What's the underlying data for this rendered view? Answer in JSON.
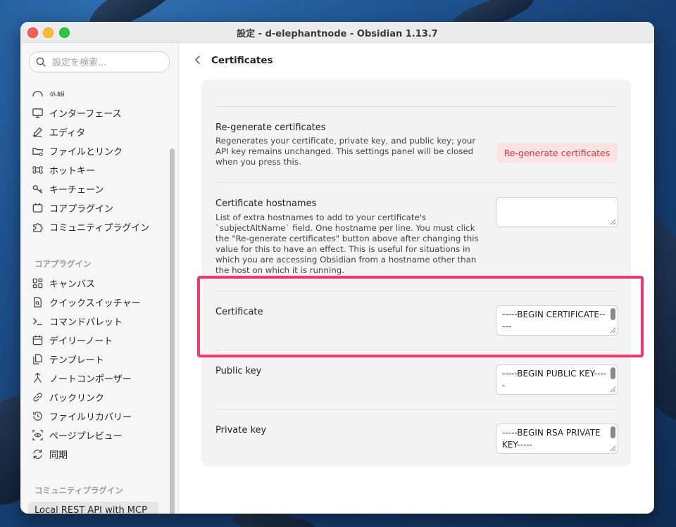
{
  "window": {
    "title": "設定 - d-elephantnode - Obsidian 1.13.7"
  },
  "sidebar": {
    "search_placeholder": "設定を検索...",
    "partial_item": "外観",
    "options_items": [
      {
        "label": "インターフェース",
        "icon": "monitor-icon"
      },
      {
        "label": "エディタ",
        "icon": "pencil-icon"
      },
      {
        "label": "ファイルとリンク",
        "icon": "folder-link-icon"
      },
      {
        "label": "ホットキー",
        "icon": "command-icon"
      },
      {
        "label": "キーチェーン",
        "icon": "key-icon"
      },
      {
        "label": "コアプラグイン",
        "icon": "calendar-plug-icon"
      },
      {
        "label": "コミュニティプラグイン",
        "icon": "puzzle-icon"
      }
    ],
    "core_plugins_header": "コアプラグイン",
    "core_plugin_items": [
      {
        "label": "キャンバス",
        "icon": "layout-dashboard-icon"
      },
      {
        "label": "クイックスイッチャー",
        "icon": "file-search-icon"
      },
      {
        "label": "コマンドパレット",
        "icon": "terminal-icon"
      },
      {
        "label": "デイリーノート",
        "icon": "calendar-icon"
      },
      {
        "label": "テンプレート",
        "icon": "files-icon"
      },
      {
        "label": "ノートコンポーザー",
        "icon": "merge-icon"
      },
      {
        "label": "バックリンク",
        "icon": "link-icon"
      },
      {
        "label": "ファイルリカバリー",
        "icon": "history-icon"
      },
      {
        "label": "ページプレビュー",
        "icon": "scan-eye-icon"
      },
      {
        "label": "同期",
        "icon": "refresh-icon"
      }
    ],
    "community_plugins_header": "コミュニティプラグイン",
    "selected_item": "Local REST API with MCP"
  },
  "content": {
    "title": "Certificates",
    "regen": {
      "name": "Re-generate certificates",
      "desc": "Regenerates your certificate, private key, and public key; your API key remains unchanged. This settings panel will be closed when you press this.",
      "button": "Re-generate certificates"
    },
    "hostnames": {
      "name": "Certificate hostnames",
      "desc": "List of extra hostnames to add to your certificate's `subjectAltName` field. One hostname per line. You must click the \"Re-generate certificates\" button above after changing this value for this to have an effect. This is useful for situations in which you are accessing Obsidian from a hostname other than the host on which it is running.",
      "value": ""
    },
    "certificate": {
      "name": "Certificate",
      "value": "-----BEGIN CERTIFICATE-----"
    },
    "public_key": {
      "name": "Public key",
      "value": "-----BEGIN PUBLIC KEY-----"
    },
    "private_key": {
      "name": "Private key",
      "value": "-----BEGIN RSA PRIVATE KEY-----"
    }
  },
  "colors": {
    "accent_red": "#e0323d",
    "highlight": "#f4386c"
  }
}
